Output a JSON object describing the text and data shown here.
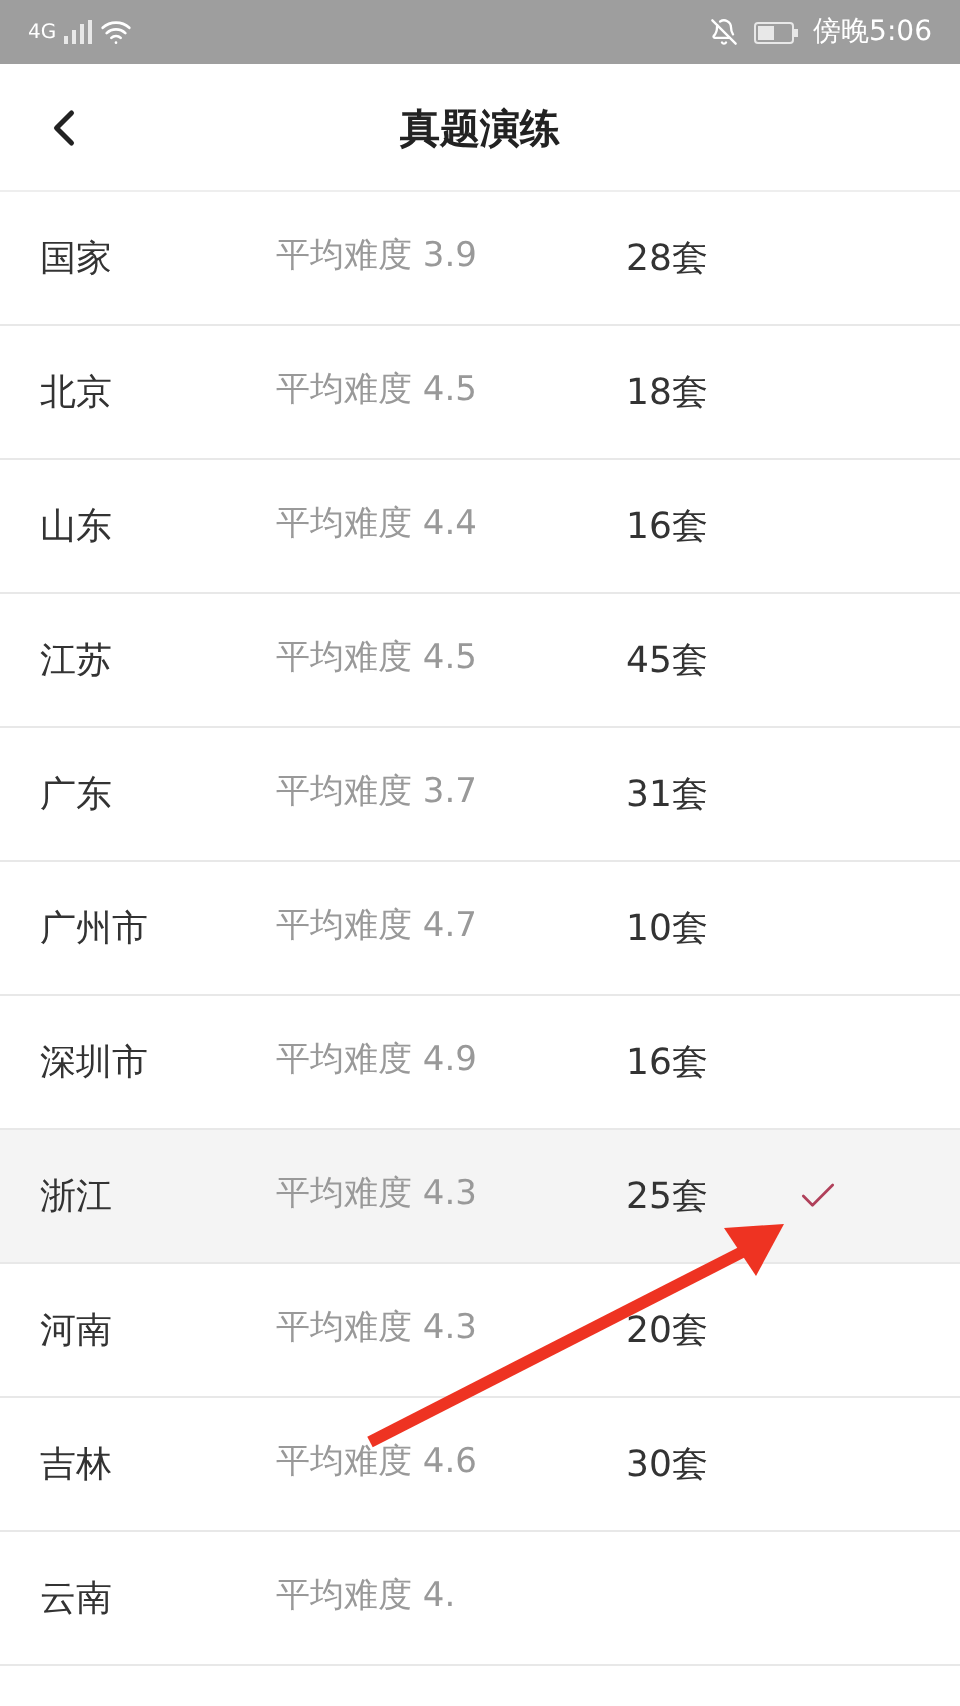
{
  "status_bar": {
    "network": "4G",
    "time": "傍晚5:06"
  },
  "header": {
    "title": "真题演练"
  },
  "rows": [
    {
      "name": "国家",
      "difficulty": "平均难度 3.9",
      "count": "28套",
      "selected": false
    },
    {
      "name": "北京",
      "difficulty": "平均难度 4.5",
      "count": "18套",
      "selected": false
    },
    {
      "name": "山东",
      "difficulty": "平均难度 4.4",
      "count": "16套",
      "selected": false
    },
    {
      "name": "江苏",
      "difficulty": "平均难度 4.5",
      "count": "45套",
      "selected": false
    },
    {
      "name": "广东",
      "difficulty": "平均难度 3.7",
      "count": "31套",
      "selected": false
    },
    {
      "name": "广州市",
      "difficulty": "平均难度 4.7",
      "count": "10套",
      "selected": false
    },
    {
      "name": "深圳市",
      "difficulty": "平均难度 4.9",
      "count": "16套",
      "selected": false
    },
    {
      "name": "浙江",
      "difficulty": "平均难度 4.3",
      "count": "25套",
      "selected": true
    },
    {
      "name": "河南",
      "difficulty": "平均难度 4.3",
      "count": "20套",
      "selected": false
    },
    {
      "name": "吉林",
      "difficulty": "平均难度 4.6",
      "count": "30套",
      "selected": false
    },
    {
      "name": "云南",
      "difficulty": "平均难度 4.",
      "selected": false
    }
  ]
}
